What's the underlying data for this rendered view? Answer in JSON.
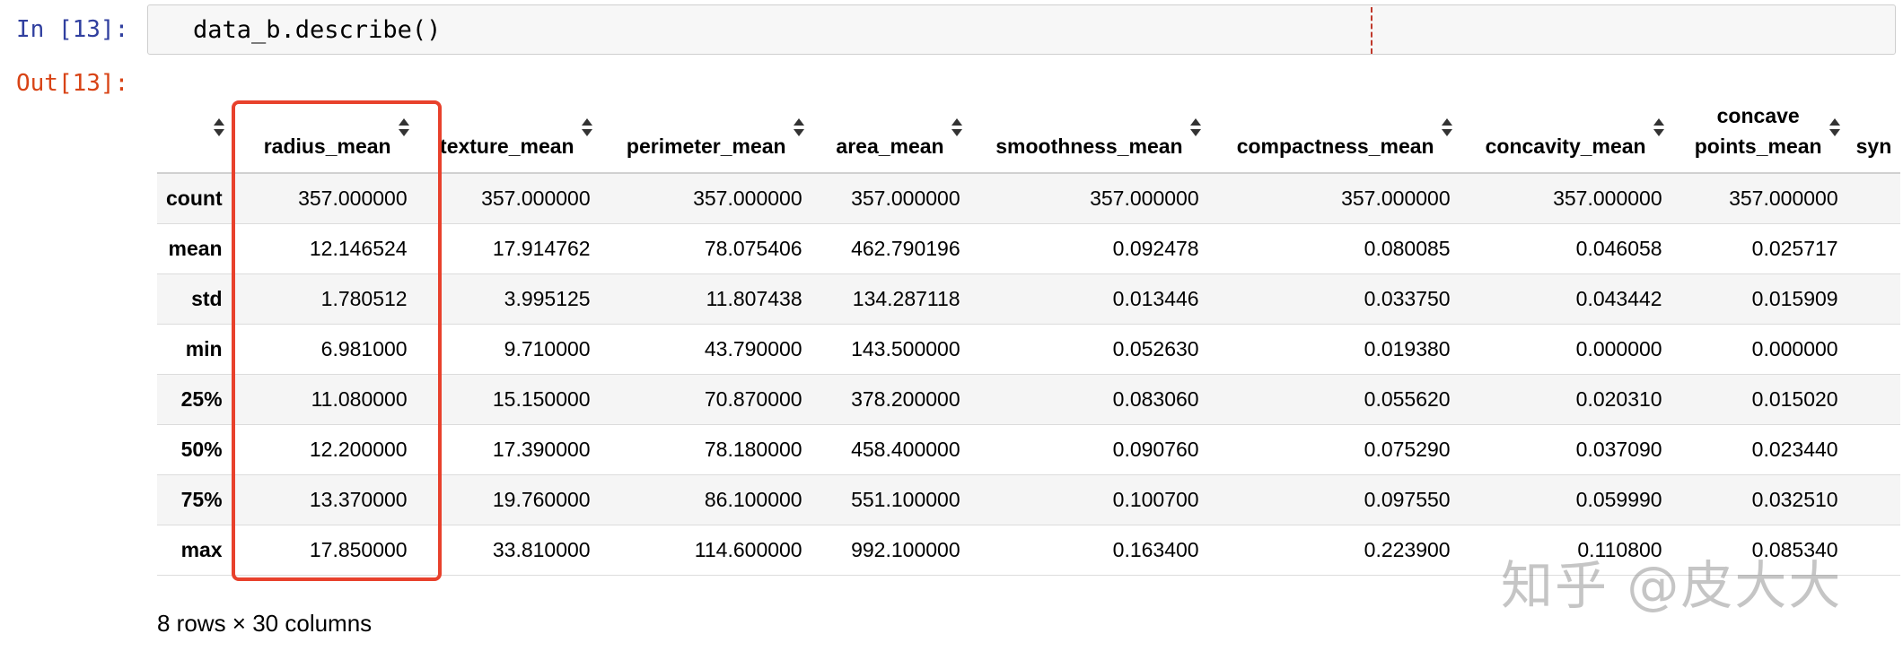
{
  "input_prompt": "In [13]:",
  "code": "data_b.describe()",
  "output_prompt": "Out[13]:",
  "table": {
    "columns": [
      {
        "line1": "",
        "line2": "radius_mean"
      },
      {
        "line1": "",
        "line2": "texture_mean"
      },
      {
        "line1": "",
        "line2": "perimeter_mean"
      },
      {
        "line1": "",
        "line2": "area_mean"
      },
      {
        "line1": "",
        "line2": "smoothness_mean"
      },
      {
        "line1": "",
        "line2": "compactness_mean"
      },
      {
        "line1": "",
        "line2": "concavity_mean"
      },
      {
        "line1": "concave",
        "line2": "points_mean"
      },
      {
        "line1": "",
        "line2": "syn"
      }
    ],
    "rows": [
      {
        "label": "count",
        "values": [
          "357.000000",
          "357.000000",
          "357.000000",
          "357.000000",
          "357.000000",
          "357.000000",
          "357.000000",
          "357.000000",
          ""
        ]
      },
      {
        "label": "mean",
        "values": [
          "12.146524",
          "17.914762",
          "78.075406",
          "462.790196",
          "0.092478",
          "0.080085",
          "0.046058",
          "0.025717",
          ""
        ]
      },
      {
        "label": "std",
        "values": [
          "1.780512",
          "3.995125",
          "11.807438",
          "134.287118",
          "0.013446",
          "0.033750",
          "0.043442",
          "0.015909",
          ""
        ]
      },
      {
        "label": "min",
        "values": [
          "6.981000",
          "9.710000",
          "43.790000",
          "143.500000",
          "0.052630",
          "0.019380",
          "0.000000",
          "0.000000",
          ""
        ]
      },
      {
        "label": "25%",
        "values": [
          "11.080000",
          "15.150000",
          "70.870000",
          "378.200000",
          "0.083060",
          "0.055620",
          "0.020310",
          "0.015020",
          ""
        ]
      },
      {
        "label": "50%",
        "values": [
          "12.200000",
          "17.390000",
          "78.180000",
          "458.400000",
          "0.090760",
          "0.075290",
          "0.037090",
          "0.023440",
          ""
        ]
      },
      {
        "label": "75%",
        "values": [
          "13.370000",
          "19.760000",
          "86.100000",
          "551.100000",
          "0.100700",
          "0.097550",
          "0.059990",
          "0.032510",
          ""
        ]
      },
      {
        "label": "max",
        "values": [
          "17.850000",
          "33.810000",
          "114.600000",
          "992.100000",
          "0.163400",
          "0.223900",
          "0.110800",
          "0.085340",
          ""
        ]
      }
    ]
  },
  "footer": "8 rows × 30 columns",
  "watermark": "知乎 @皮大大",
  "colors": {
    "input_prompt": "#303F9F",
    "output_prompt": "#D84315",
    "highlight": "#e8412c"
  }
}
